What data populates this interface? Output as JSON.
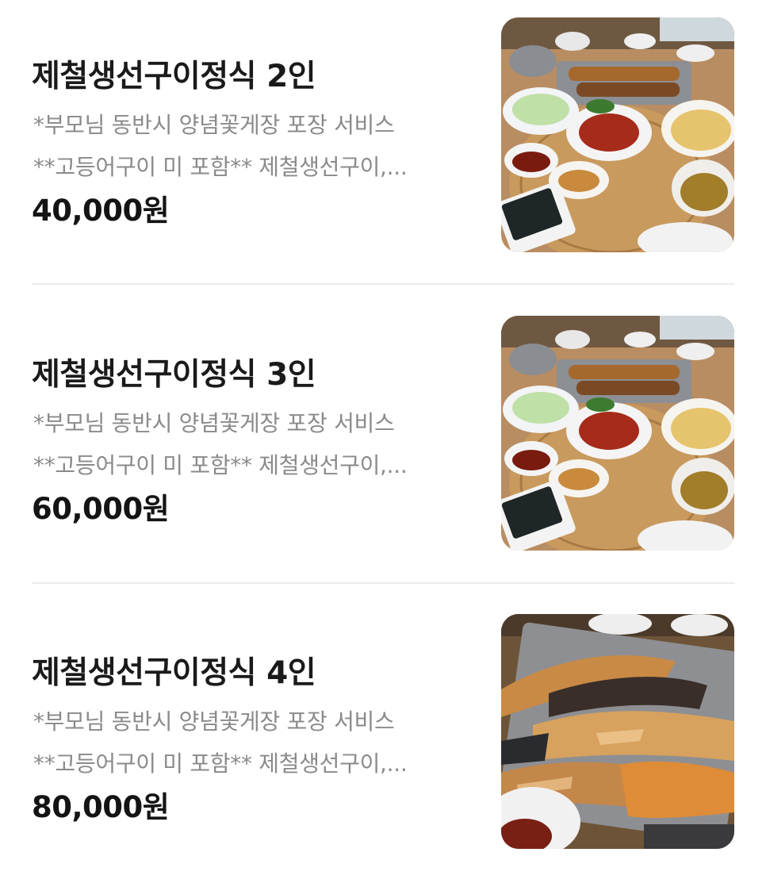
{
  "menu": {
    "items": [
      {
        "name": "제철생선구이정식 2인",
        "description_line1": "*부모님 동반시 양념꽃게장 포장 서비스",
        "description_line2": "**고등어구이 미 포함** 제철생선구이,...",
        "price": "40,000원"
      },
      {
        "name": "제철생선구이정식 3인",
        "description_line1": "*부모님 동반시 양념꽃게장 포장 서비스",
        "description_line2": "**고등어구이 미 포함** 제철생선구이,...",
        "price": "60,000원"
      },
      {
        "name": "제철생선구이정식 4인",
        "description_line1": "*부모님 동반시 양념꽃게장 포장 서비스",
        "description_line2": "**고등어구이 미 포함** 제철생선구이,...",
        "price": "80,000원"
      }
    ]
  },
  "colors": {
    "title": "#1a1a1a",
    "description": "#8a8a8a",
    "price": "#141414",
    "divider": "#ececec"
  }
}
